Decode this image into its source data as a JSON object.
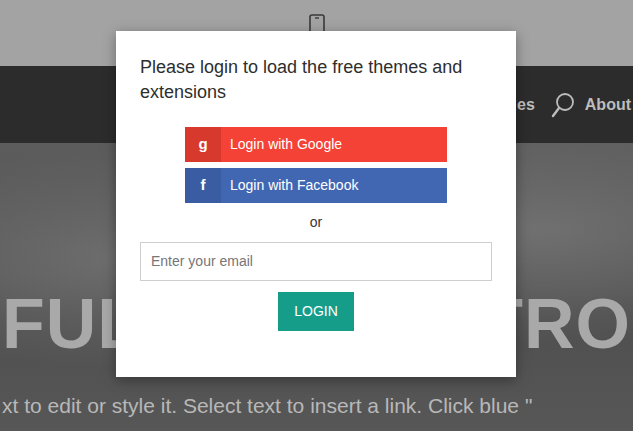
{
  "page": {
    "nav_items": [
      {
        "label": "es"
      },
      {
        "label": "About"
      }
    ],
    "hero": {
      "headline_left": "FUL",
      "headline_right": "TRO",
      "caption": "xt to edit or style it. Select text to insert a link. Click blue \""
    }
  },
  "dialog": {
    "title": "Please login to load the free themes and extensions",
    "buttons": [
      {
        "label": "Login with Google",
        "icon": "g",
        "kind": "google"
      },
      {
        "label": "Login with Facebook",
        "icon": "f",
        "kind": "facebook"
      }
    ],
    "separator": "or",
    "email": {
      "placeholder": "Enter your email"
    },
    "submit": "LOGIN"
  }
}
